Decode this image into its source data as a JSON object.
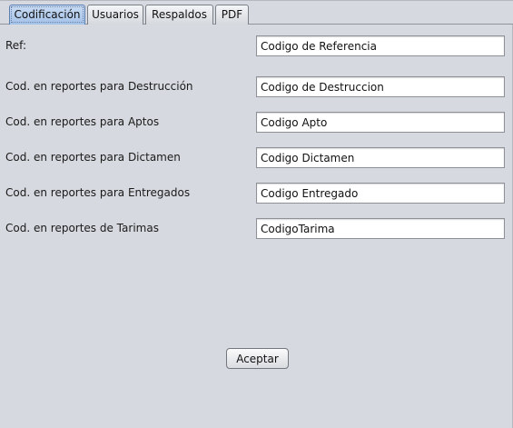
{
  "tabs": [
    {
      "label": "Codificación",
      "selected": true
    },
    {
      "label": "Usuarios"
    },
    {
      "label": "Respaldos"
    },
    {
      "label": "PDF"
    }
  ],
  "form": {
    "rows": [
      {
        "label": "Ref:",
        "value": "Codigo de Referencia"
      },
      {
        "label": "Cod. en reportes para Destrucción",
        "value": "Codigo de Destruccion"
      },
      {
        "label": "Cod. en reportes para Aptos",
        "value": "Codigo Apto"
      },
      {
        "label": "Cod. en reportes para Dictamen",
        "value": "Codigo Dictamen"
      },
      {
        "label": "Cod. en reportes para Entregados",
        "value": "Codigo Entregado"
      },
      {
        "label": "Cod. en reportes de Tarimas",
        "value": "CodigoTarima"
      }
    ]
  },
  "actions": {
    "accept_label": "Aceptar"
  },
  "colors": {
    "selected_tab": "#a3c1e8",
    "background": "#d6d9df"
  }
}
